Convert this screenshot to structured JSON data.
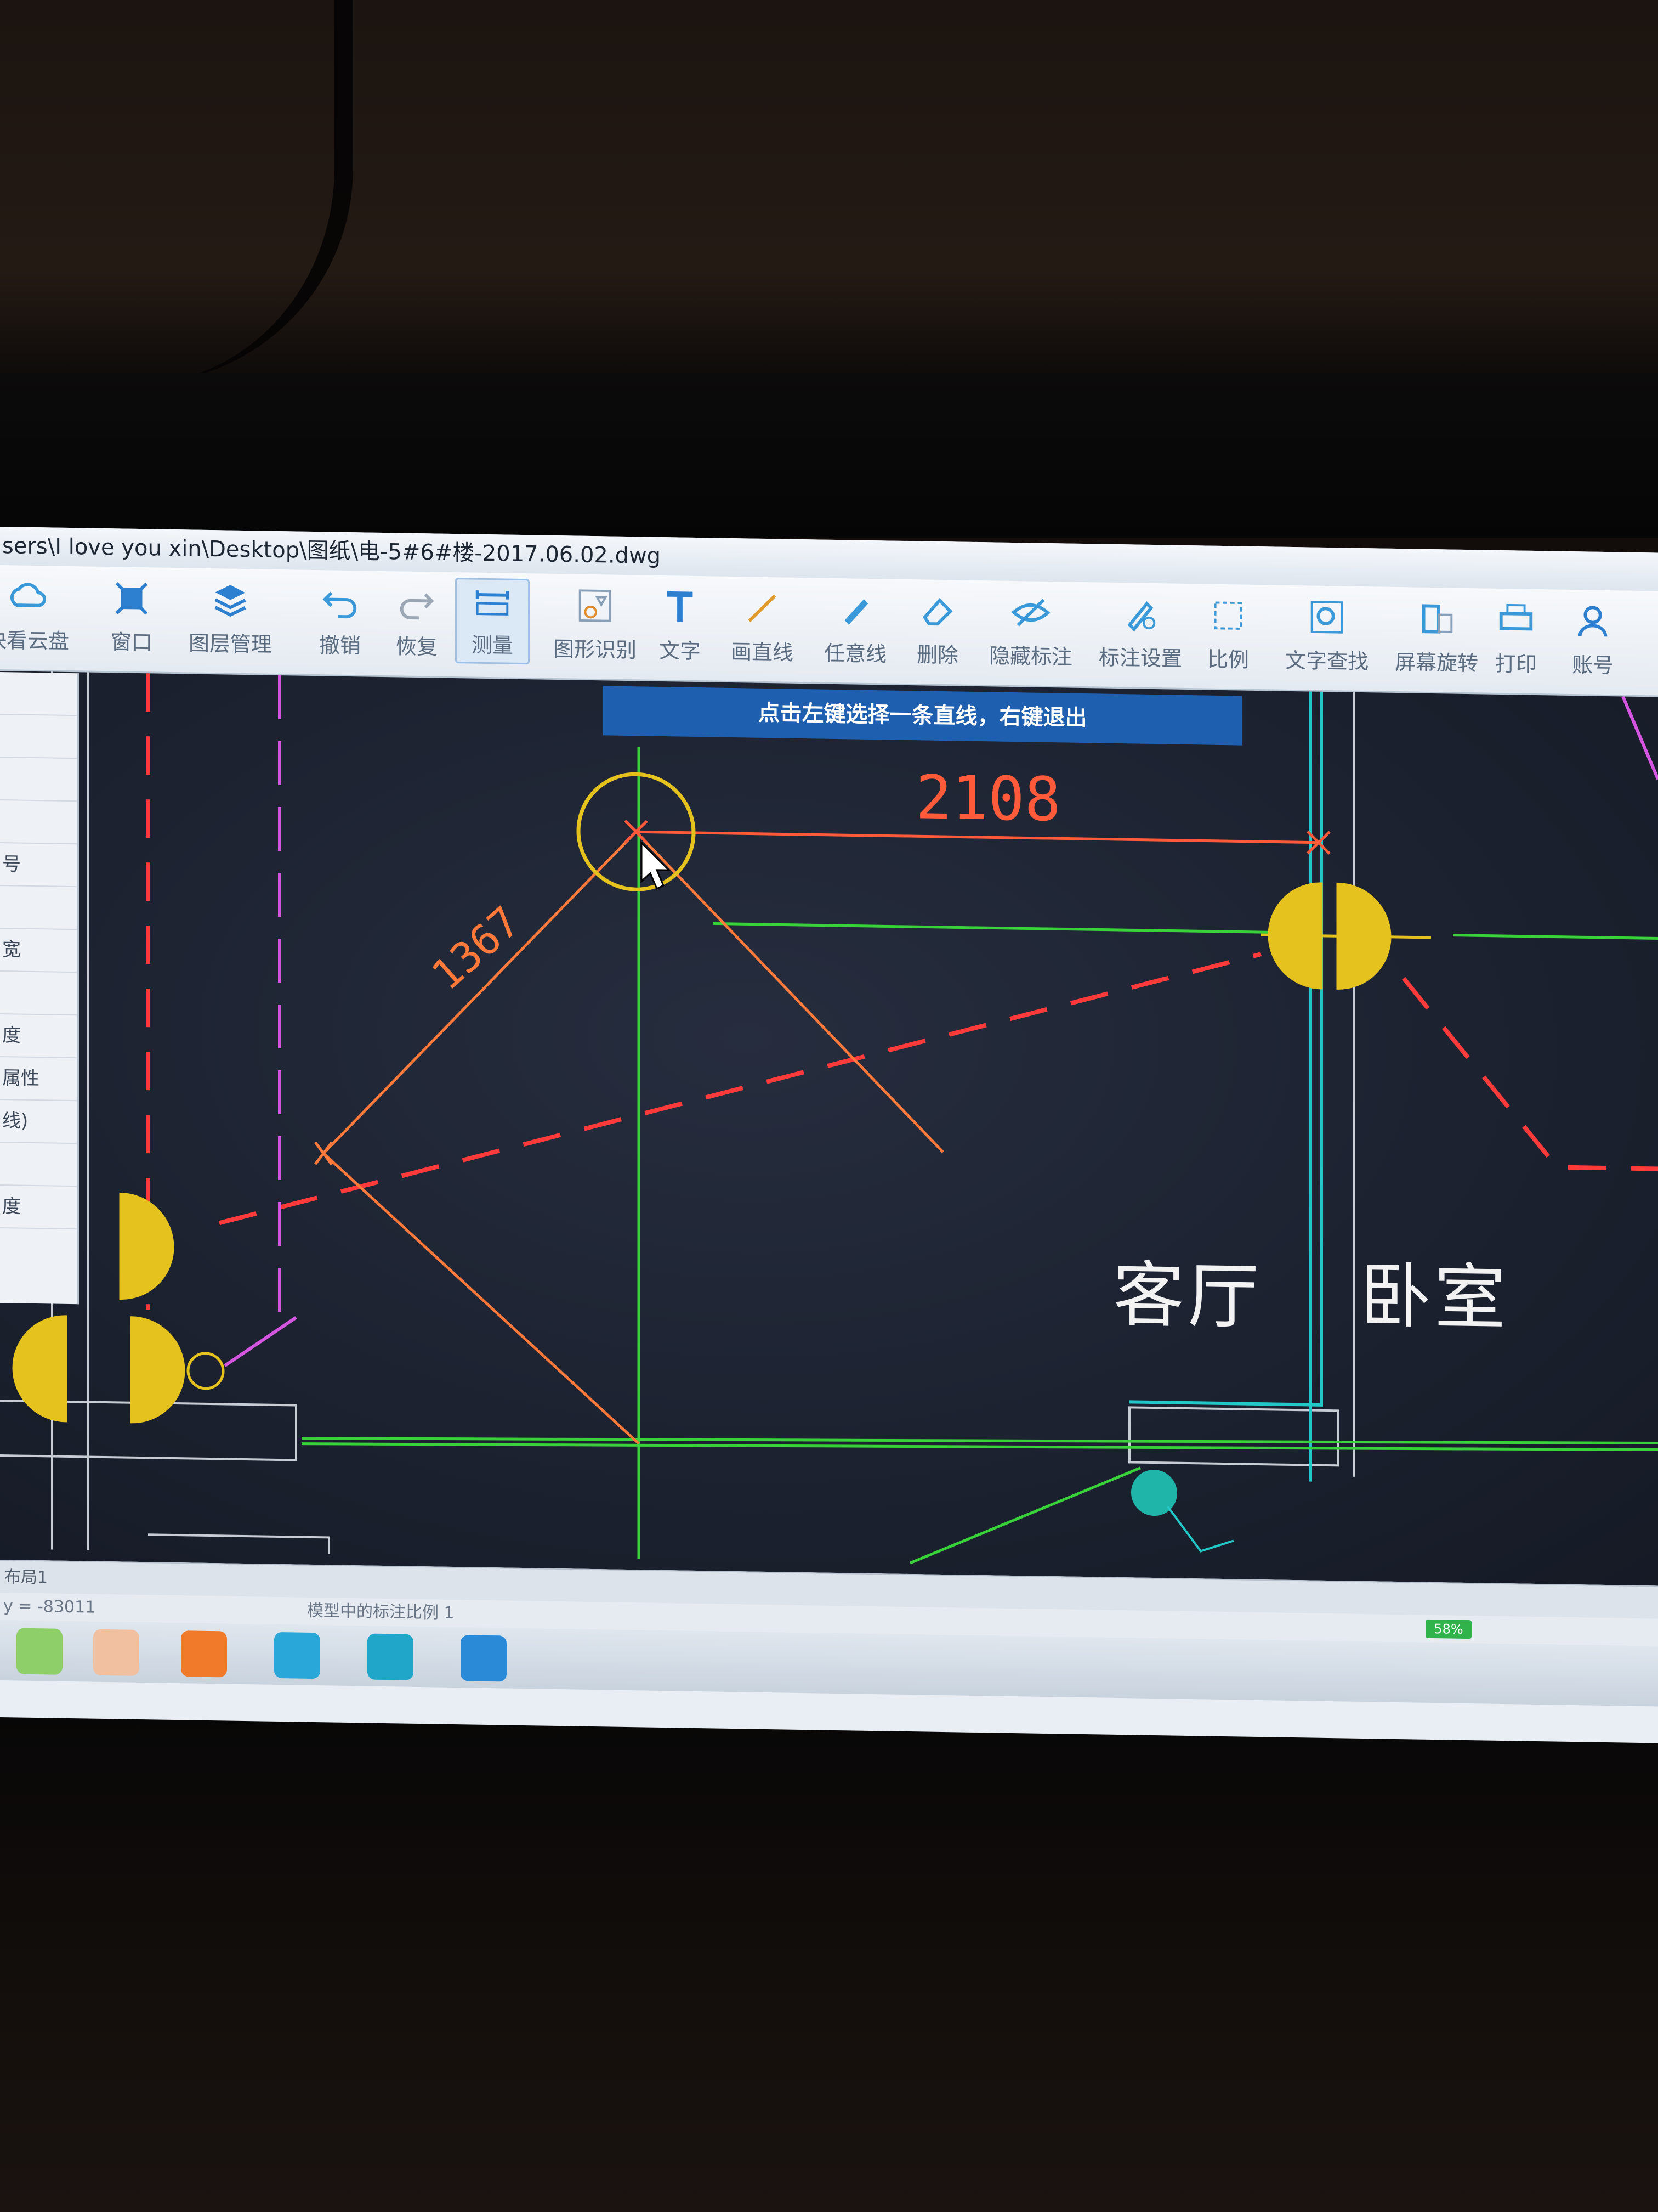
{
  "window": {
    "title": "sers\\I love you  xin\\Desktop\\图纸\\电-5#6#楼-2017.06.02.dwg"
  },
  "toolbar": {
    "items": [
      {
        "label": "快看云盘",
        "icon": "cloud-icon"
      },
      {
        "label": "窗口",
        "icon": "window-icon"
      },
      {
        "label": "图层管理",
        "icon": "layers-icon"
      },
      {
        "label": "撤销",
        "icon": "undo-icon"
      },
      {
        "label": "恢复",
        "icon": "redo-icon"
      },
      {
        "label": "测量",
        "icon": "measure-icon"
      },
      {
        "label": "图形识别",
        "icon": "shape-recognition-icon"
      },
      {
        "label": "文字",
        "icon": "text-icon"
      },
      {
        "label": "画直线",
        "icon": "line-icon"
      },
      {
        "label": "任意线",
        "icon": "pen-icon"
      },
      {
        "label": "删除",
        "icon": "eraser-icon"
      },
      {
        "label": "隐藏标注",
        "icon": "hide-icon"
      },
      {
        "label": "标注设置",
        "icon": "annotation-settings-icon"
      },
      {
        "label": "比例",
        "icon": "scale-icon"
      },
      {
        "label": "文字查找",
        "icon": "text-search-icon"
      },
      {
        "label": "屏幕旋转",
        "icon": "rotate-screen-icon"
      },
      {
        "label": "打印",
        "icon": "print-icon"
      },
      {
        "label": "账号",
        "icon": "account-icon"
      }
    ],
    "active": "测量"
  },
  "left_panel": {
    "rows": [
      "",
      "",
      "",
      "",
      "号",
      "",
      "宽",
      "",
      "度",
      "属性",
      "线)",
      "",
      "度"
    ]
  },
  "canvas": {
    "hint": "点击左键选择一条直线，右键退出",
    "dimension_horizontal": "2108",
    "dimension_diagonal": "1367",
    "room_living": "客厅",
    "room_bedroom": "卧室",
    "colors": {
      "background": "#1c2230",
      "dimension": "#ff5a3a",
      "wall_green": "#39d23a",
      "dashed_red": "#ff3a3a",
      "fixture_yellow": "#e6c21e",
      "cyan": "#22c8c8",
      "magenta": "#d455e0"
    }
  },
  "tabs": {
    "label": "布局1"
  },
  "status": {
    "coord": "y = -83011",
    "scale": "模型中的标注比例 1",
    "battery": "58%"
  }
}
